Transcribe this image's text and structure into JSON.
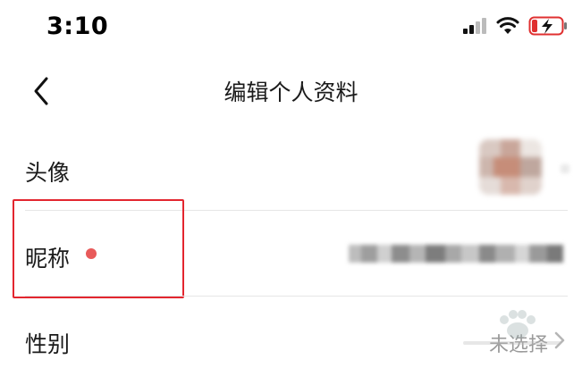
{
  "status_bar": {
    "time": "3:10",
    "icons": [
      "signal-icon",
      "wifi-icon",
      "battery-charging-icon"
    ]
  },
  "nav": {
    "title": "编辑个人资料",
    "back_icon": "chevron-left-icon"
  },
  "rows": [
    {
      "label": "头像",
      "value_type": "avatar-image"
    },
    {
      "label": "昵称",
      "required_marker": true,
      "value_type": "obscured-text"
    },
    {
      "label": "性别",
      "value": "未选择",
      "trailing_icon": "chevron-right-icon"
    }
  ],
  "colors": {
    "required_dot": "#e85a5a",
    "highlight_border": "#e3262f",
    "value_gray": "#9a9a9a",
    "divider": "#e6e6e6"
  }
}
